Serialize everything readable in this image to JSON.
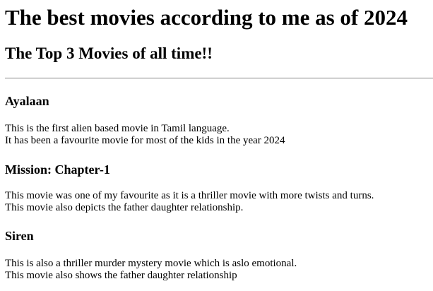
{
  "page": {
    "title": "The best movies according to me as of 2024",
    "subtitle": "The Top 3 Movies of all time!!"
  },
  "movies": [
    {
      "title": "Ayalaan",
      "lines": [
        "This is the first alien based movie in Tamil language.",
        "It has been a favourite movie for most of the kids in the year 2024"
      ]
    },
    {
      "title": "Mission: Chapter-1",
      "lines": [
        "This movie was one of my favourite as it is a thriller movie with more twists and turns.",
        "This movie also depicts the father daughter relationship."
      ]
    },
    {
      "title": "Siren",
      "lines": [
        "This is also a thriller murder mystery movie which is aslo emotional.",
        "This movie also shows the father daughter relationship"
      ]
    }
  ]
}
